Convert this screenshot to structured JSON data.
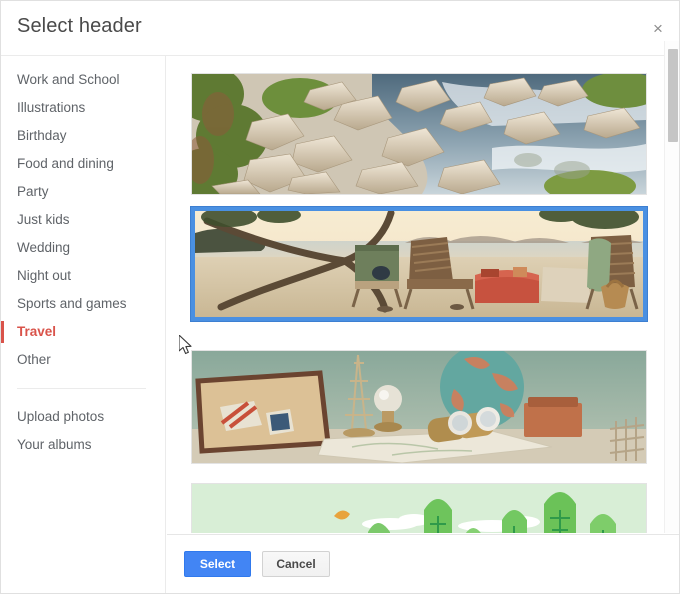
{
  "dialog": {
    "title": "Select header",
    "close_label": "×"
  },
  "sidebar": {
    "items": [
      {
        "label": "Work and School",
        "selected": false
      },
      {
        "label": "Illustrations",
        "selected": false
      },
      {
        "label": "Birthday",
        "selected": false
      },
      {
        "label": "Food and dining",
        "selected": false
      },
      {
        "label": "Party",
        "selected": false
      },
      {
        "label": "Just kids",
        "selected": false
      },
      {
        "label": "Wedding",
        "selected": false
      },
      {
        "label": "Night out",
        "selected": false
      },
      {
        "label": "Sports and games",
        "selected": false
      },
      {
        "label": "Travel",
        "selected": true
      },
      {
        "label": "Other",
        "selected": false
      }
    ],
    "secondary_items": [
      {
        "label": "Upload photos"
      },
      {
        "label": "Your albums"
      }
    ],
    "selected_color": "#d9534a",
    "text_color": "#5f6368"
  },
  "gallery": {
    "thumbnails": [
      {
        "name": "rocky-river-stream",
        "alt": "Rocky mountain stream with white boulders and green brush",
        "selected": false
      },
      {
        "name": "beach-sunset-chairs",
        "alt": "Sunset beach with lounge chairs under a leaning tree",
        "selected": true
      },
      {
        "name": "vintage-travel-globe",
        "alt": "Vintage suitcase, Eiffel Tower figurine, globe, binoculars and map",
        "selected": false
      },
      {
        "name": "forest-illustration",
        "alt": "Flat illustration of green trees, clouds and an orange bird",
        "selected": false
      }
    ],
    "selection_border_color": "#4a90e2"
  },
  "footer": {
    "select_label": "Select",
    "cancel_label": "Cancel",
    "select_color": "#4285f4"
  },
  "scrollbar": {
    "thumb_color": "#c5c5c5"
  }
}
